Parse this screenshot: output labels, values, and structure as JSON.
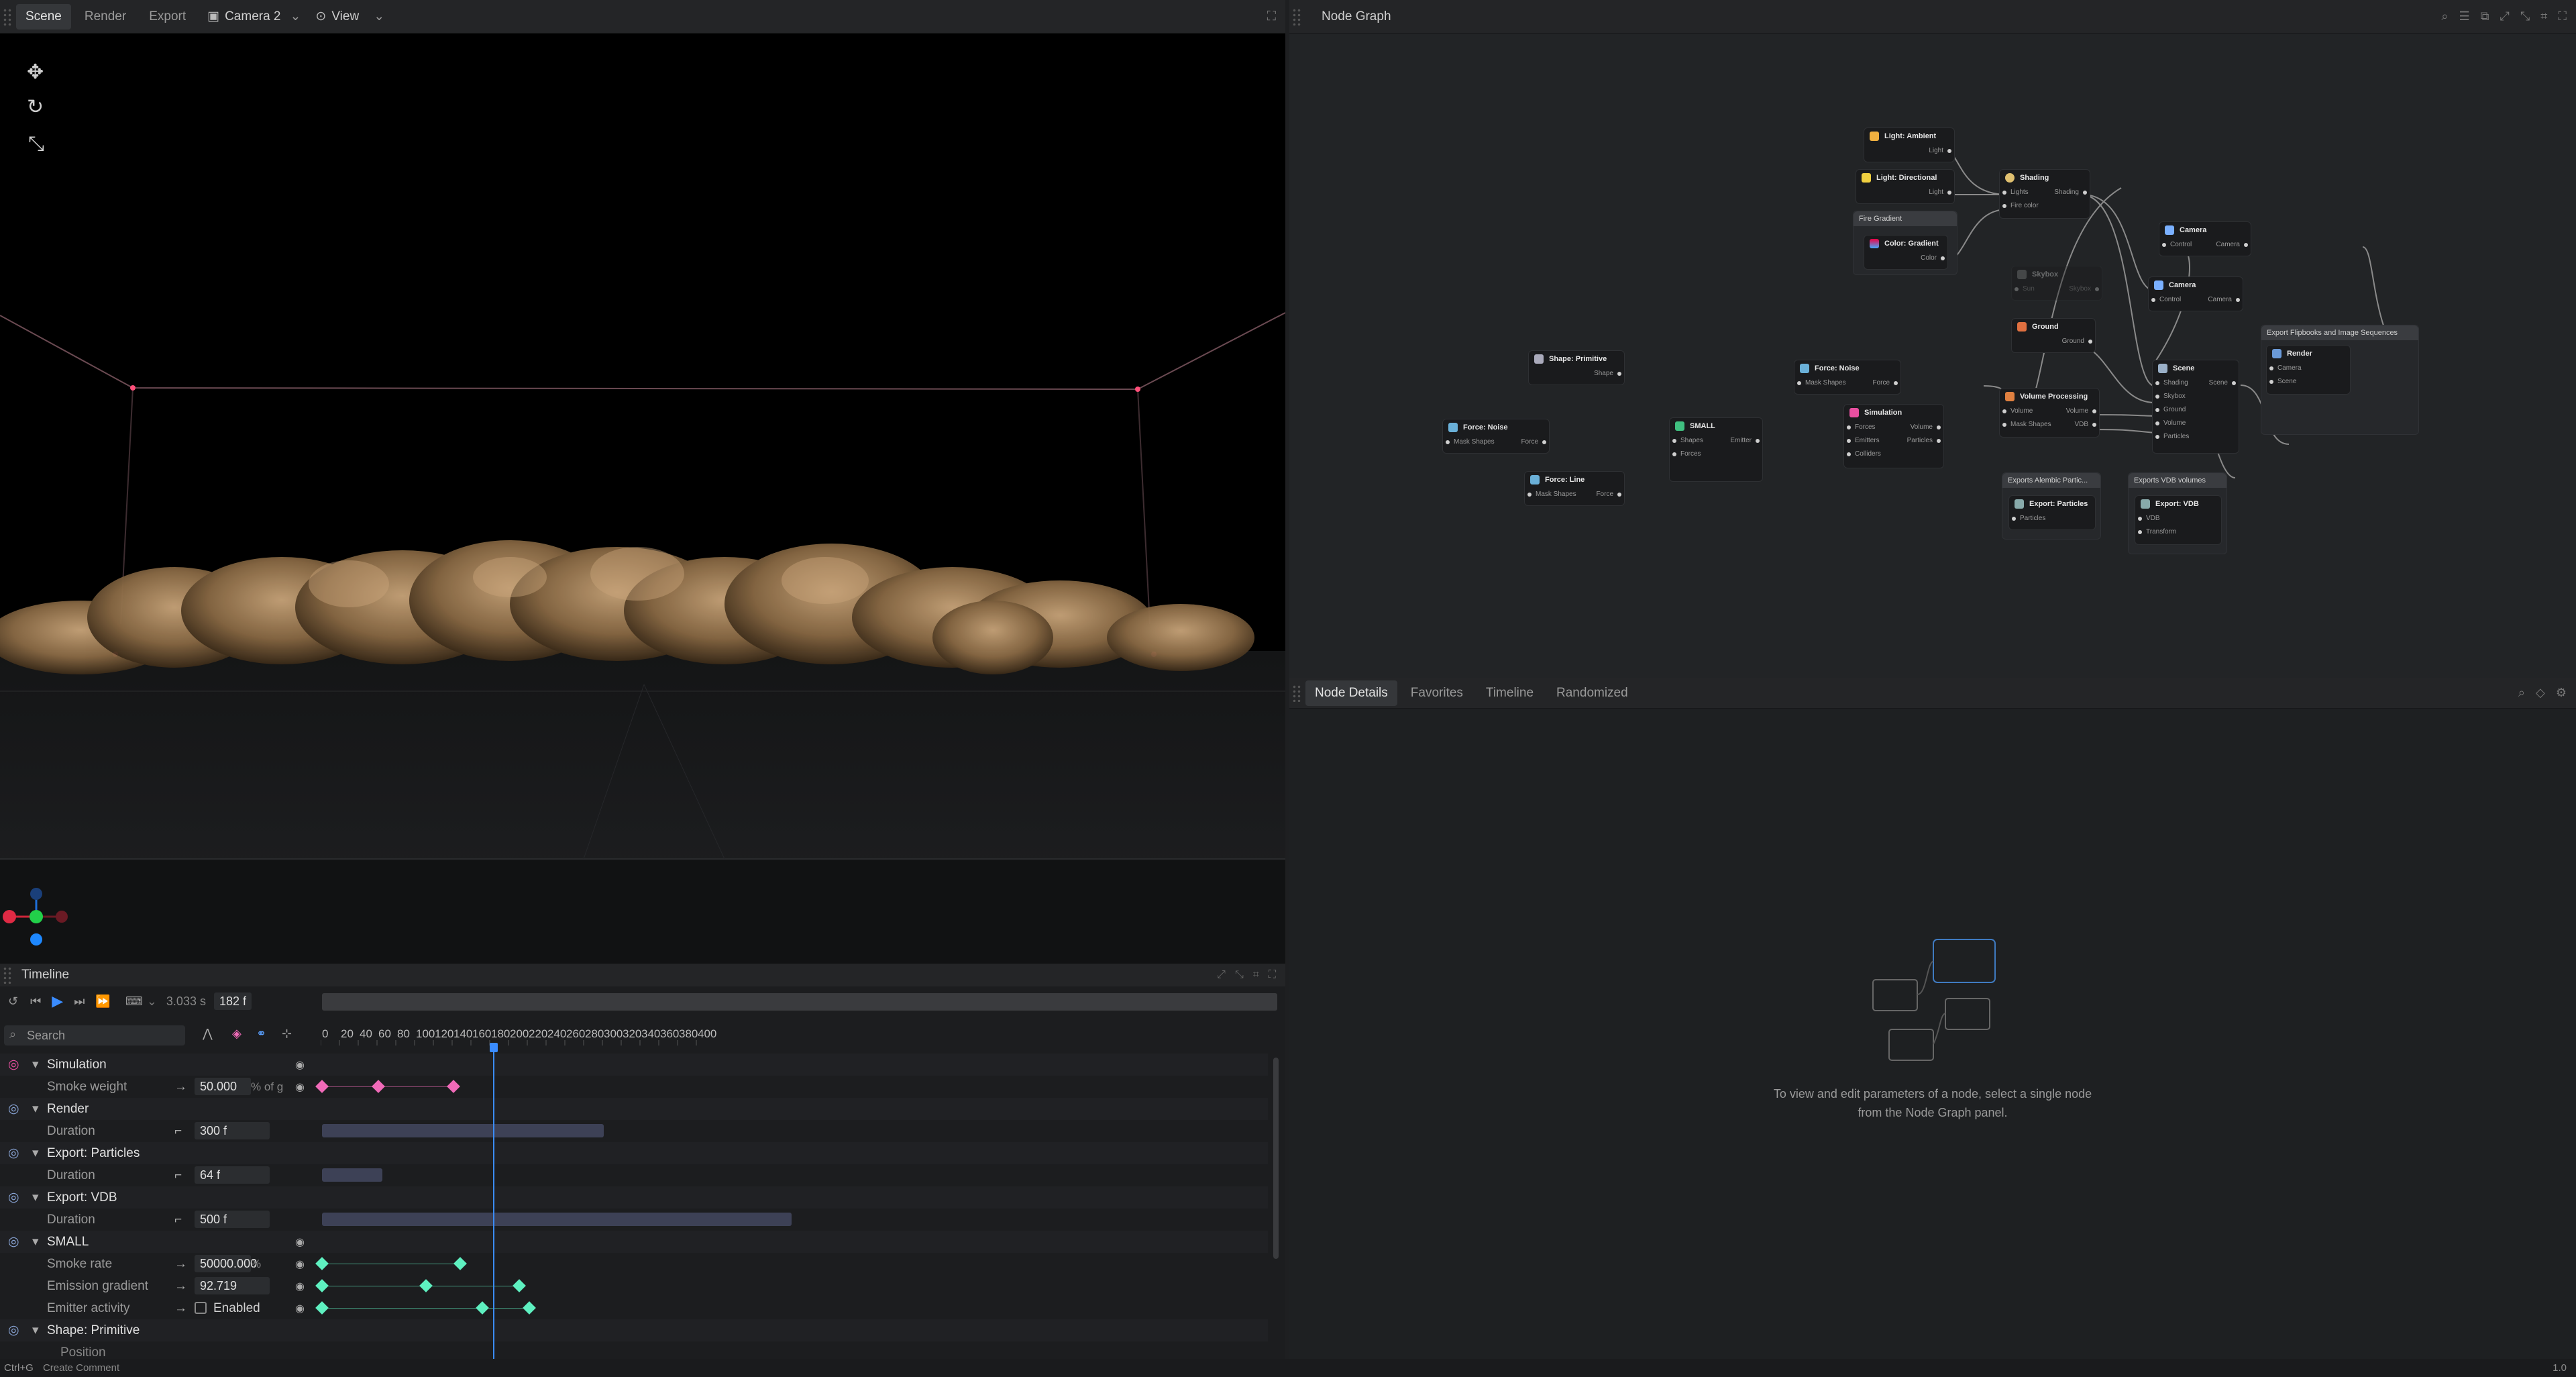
{
  "left_header": {
    "tabs": [
      "Scene",
      "Render",
      "Export"
    ],
    "camera": "Camera 2",
    "view": "View"
  },
  "node_graph": {
    "title": "Node Graph",
    "nodes": [
      {
        "title": "Light: Ambient",
        "ports": [
          "Light"
        ]
      },
      {
        "title": "Light: Directional",
        "ports": [
          "Light"
        ]
      },
      {
        "title": "Fire Gradient"
      },
      {
        "title": "Color: Gradient",
        "ports": [
          "Color"
        ]
      },
      {
        "title": "Shading",
        "ports": [
          "Lights",
          "Shading",
          "Fire color"
        ]
      },
      {
        "title": "Camera",
        "ports": [
          "Control",
          "Camera"
        ]
      },
      {
        "title": "Camera",
        "ports": [
          "Control",
          "Camera"
        ]
      },
      {
        "title": "Skybox",
        "ports": [
          "Sun",
          "Skybox"
        ]
      },
      {
        "title": "Ground",
        "ports": [
          "Ground"
        ]
      },
      {
        "title": "Export Flipbooks and Image Sequences"
      },
      {
        "title": "Render",
        "ports": [
          "Camera",
          "Scene"
        ]
      },
      {
        "title": "Scene",
        "ports": [
          "Shading",
          "Scene",
          "Skybox",
          "Ground",
          "Volume",
          "Particles"
        ]
      },
      {
        "title": "Shape: Primitive",
        "ports": [
          "Shape"
        ]
      },
      {
        "title": "Force: Noise",
        "ports": [
          "Mask Shapes",
          "Force"
        ]
      },
      {
        "title": "Force: Noise",
        "ports": [
          "Mask Shapes",
          "Force"
        ]
      },
      {
        "title": "SMALL",
        "ports": [
          "Shapes",
          "Emitter",
          "Forces"
        ]
      },
      {
        "title": "Force: Line",
        "ports": [
          "Mask Shapes",
          "Force"
        ]
      },
      {
        "title": "Simulation",
        "ports": [
          "Forces",
          "Volume",
          "Emitters",
          "Particles",
          "Colliders"
        ]
      },
      {
        "title": "Volume Processing",
        "ports": [
          "Volume",
          "Volume",
          "Mask Shapes",
          "VDB"
        ]
      },
      {
        "title": "Exports Alembic Partic..."
      },
      {
        "title": "Export: Particles",
        "ports": [
          "Particles"
        ]
      },
      {
        "title": "Exports VDB volumes"
      },
      {
        "title": "Export: VDB",
        "ports": [
          "VDB",
          "Transform"
        ]
      }
    ]
  },
  "details": {
    "tabs": [
      "Node Details",
      "Favorites",
      "Timeline",
      "Randomized"
    ],
    "empty_text_1": "To view and edit parameters of a node, select a single node",
    "empty_text_2": "from the Node Graph panel."
  },
  "timeline": {
    "title": "Timeline",
    "time_seconds": "3.033 s",
    "frame": "182 f",
    "search_placeholder": "Search",
    "ticks": [
      0,
      20,
      40,
      60,
      80,
      100,
      120,
      140,
      160,
      180,
      200,
      220,
      240,
      260,
      280,
      300,
      320,
      340,
      360,
      380,
      400
    ],
    "playhead_frame": 182,
    "tracks": [
      {
        "name": "Simulation",
        "type": "group",
        "color": "#e84fa0"
      },
      {
        "name": "Smoke weight",
        "value": "50.000",
        "unit": "% of g",
        "keys": [
          0,
          60,
          140
        ],
        "color": "#f06ab8"
      },
      {
        "name": "Render",
        "type": "group"
      },
      {
        "name": "Duration",
        "value": "300 f",
        "bar": [
          0,
          300
        ]
      },
      {
        "name": "Export: Particles",
        "type": "group"
      },
      {
        "name": "Duration",
        "value": "64 f",
        "bar": [
          0,
          64
        ]
      },
      {
        "name": "Export: VDB",
        "type": "group"
      },
      {
        "name": "Duration",
        "value": "500 f",
        "bar": [
          0,
          500
        ]
      },
      {
        "name": "SMALL",
        "type": "group"
      },
      {
        "name": "Smoke rate",
        "value": "50000.000",
        "unit": "%",
        "keys": [
          0,
          147
        ],
        "color": "#5ef0c0"
      },
      {
        "name": "Emission gradient",
        "value": "92.719",
        "keys": [
          0,
          111,
          210
        ],
        "color": "#5ef0c0"
      },
      {
        "name": "Emitter activity",
        "value": "Enabled",
        "keys": [
          0,
          171,
          221
        ],
        "color": "#5ef0c0"
      },
      {
        "name": "Shape: Primitive",
        "type": "group"
      },
      {
        "name": "Position",
        "type": "sub"
      }
    ]
  },
  "status": {
    "shortcut": "Ctrl+G",
    "hint": "Create Comment",
    "version": "1.0"
  }
}
